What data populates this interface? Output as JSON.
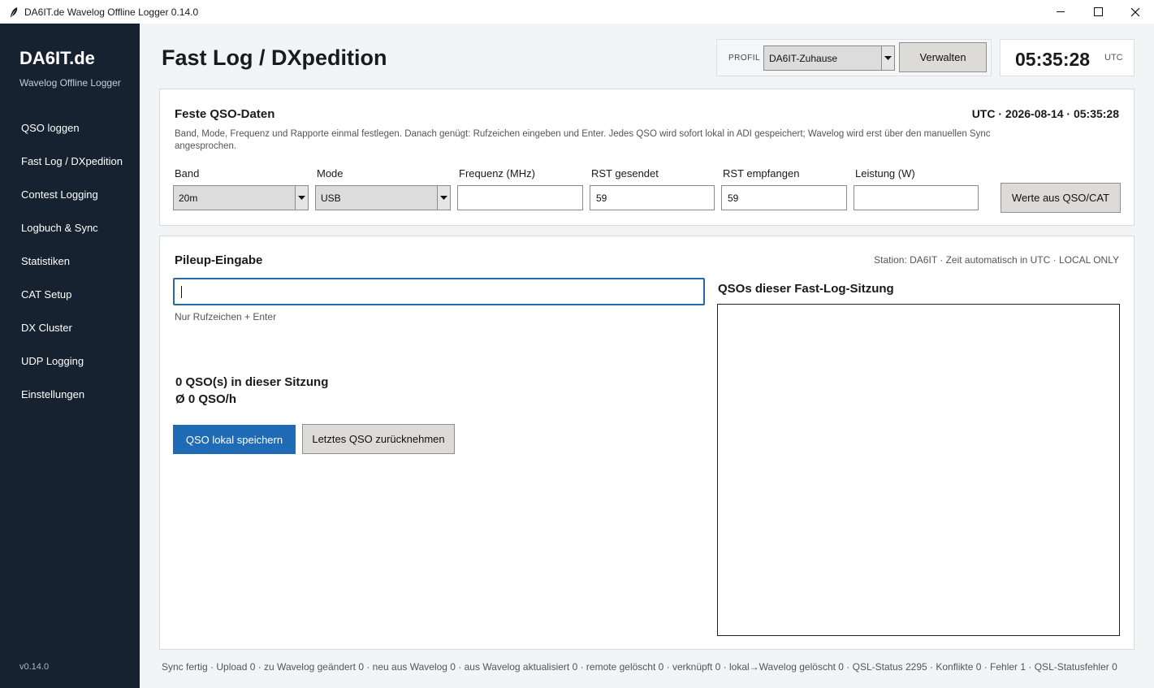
{
  "window": {
    "title": "DA6IT.de Wavelog Offline Logger 0.14.0",
    "icons": [
      "feather-icon",
      "minimize-icon",
      "maximize-icon",
      "close-icon"
    ]
  },
  "sidebar": {
    "brand": "DA6IT.de",
    "subtitle": "Wavelog Offline Logger",
    "items": [
      {
        "label": "QSO loggen"
      },
      {
        "label": "Fast Log / DXpedition"
      },
      {
        "label": "Contest Logging"
      },
      {
        "label": "Logbuch & Sync"
      },
      {
        "label": "Statistiken"
      },
      {
        "label": "CAT Setup"
      },
      {
        "label": "DX Cluster"
      },
      {
        "label": "UDP Logging"
      },
      {
        "label": "Einstellungen"
      }
    ],
    "version": "v0.14.0"
  },
  "header": {
    "title": "Fast Log / DXpedition",
    "profile_label": "PROFIL",
    "profile_value": "DA6IT-Zuhause",
    "manage_button": "Verwalten",
    "clock": "05:35:28",
    "clock_tz": "UTC"
  },
  "fixed_data": {
    "title": "Feste QSO-Daten",
    "utc_datetime": "UTC · 2026-08-14 · 05:35:28",
    "description": "Band, Mode, Frequenz und Rapporte einmal festlegen. Danach genügt: Rufzeichen eingeben und Enter. Jedes QSO wird sofort lokal in ADI gespeichert; Wavelog wird erst über den manuellen Sync angesprochen.",
    "band_label": "Band",
    "band_value": "20m",
    "mode_label": "Mode",
    "mode_value": "USB",
    "freq_label": "Frequenz (MHz)",
    "freq_value": "",
    "rst_sent_label": "RST gesendet",
    "rst_sent_value": "59",
    "rst_rcvd_label": "RST empfangen",
    "rst_rcvd_value": "59",
    "power_label": "Leistung (W)",
    "power_value": "",
    "from_cat_button": "Werte aus QSO/CAT"
  },
  "pileup": {
    "title": "Pileup-Eingabe",
    "status": "Station: DA6IT · Zeit automatisch in UTC · LOCAL ONLY",
    "callsign_value": "",
    "hint": "Nur Rufzeichen + Enter",
    "session_count": "0 QSO(s) in dieser Sitzung",
    "rate": "Ø 0 QSO/h",
    "save_button": "QSO lokal speichern",
    "undo_button": "Letztes QSO zurücknehmen",
    "session_list_title": "QSOs dieser Fast-Log-Sitzung"
  },
  "footer": {
    "status": "Sync fertig · Upload 0 · zu Wavelog geändert 0 · neu aus Wavelog 0 · aus Wavelog aktualisiert 0 · remote gelöscht 0 · verknüpft 0 · lokal→Wavelog gelöscht 0 · QSL-Status 2295 · Konflikte 0 · Fehler 1 · QSL-Statusfehler 0"
  },
  "colors": {
    "sidebar_bg": "#16222f",
    "accent": "#1f6bb5",
    "focus_border": "#2a6aa4"
  }
}
